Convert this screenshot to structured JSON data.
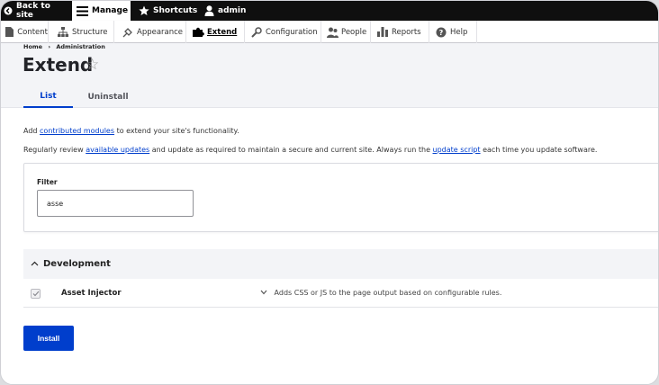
{
  "toolbar": {
    "back_label": "Back to site",
    "manage_label": "Manage",
    "shortcuts_label": "Shortcuts",
    "user_label": "admin"
  },
  "tray": {
    "items": [
      {
        "label": "Content",
        "icon": "content-icon"
      },
      {
        "label": "Structure",
        "icon": "structure-icon"
      },
      {
        "label": "Appearance",
        "icon": "appearance-icon"
      },
      {
        "label": "Extend",
        "icon": "extend-icon",
        "active": true
      },
      {
        "label": "Configuration",
        "icon": "wrench-icon"
      },
      {
        "label": "People",
        "icon": "people-icon"
      },
      {
        "label": "Reports",
        "icon": "reports-icon"
      },
      {
        "label": "Help",
        "icon": "help-icon"
      }
    ]
  },
  "breadcrumb": {
    "home": "Home",
    "separator": "›",
    "current": "Administration"
  },
  "page": {
    "title": "Extend",
    "star": "☆"
  },
  "tabs": [
    {
      "label": "List",
      "active": true
    },
    {
      "label": "Uninstall",
      "active": false
    }
  ],
  "intro": {
    "line1_prefix": "Add ",
    "line1_link": "contributed modules",
    "line1_suffix": " to extend your site's functionality.",
    "line2_prefix": "Regularly review ",
    "line2_link1": "available updates",
    "line2_middle": " and update as required to maintain a secure and current site. Always run the ",
    "line2_link2": "update script",
    "line2_suffix": " each time you update software."
  },
  "filter": {
    "label": "Filter",
    "value": "asse"
  },
  "package": {
    "name": "Development",
    "modules": [
      {
        "name": "Asset Injector",
        "checked": true,
        "description": "Adds CSS or JS to the page output based on configurable rules."
      }
    ]
  },
  "install_button": "Install",
  "colors": {
    "primary": "#003ecc",
    "toolbar": "#0f0f0f"
  }
}
